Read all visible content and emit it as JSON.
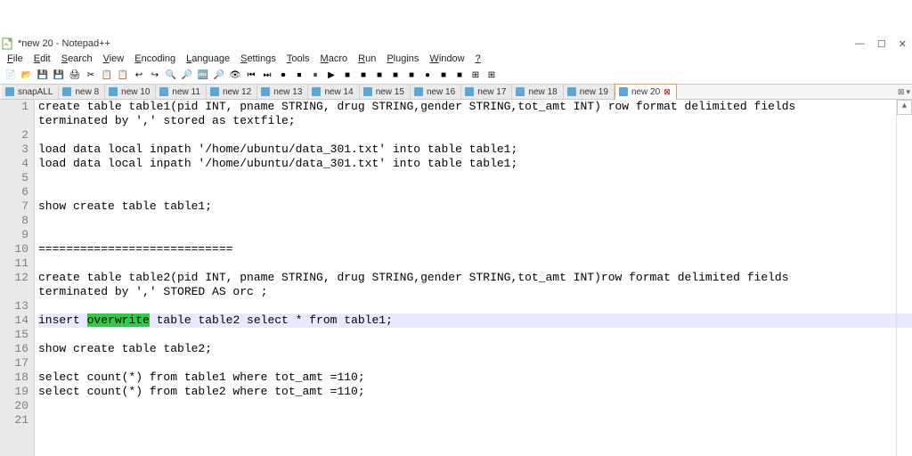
{
  "title": "*new 20 - Notepad++",
  "menu": [
    "File",
    "Edit",
    "Search",
    "View",
    "Encoding",
    "Language",
    "Settings",
    "Tools",
    "Macro",
    "Run",
    "Plugins",
    "Window",
    "?"
  ],
  "toolbar_icons": [
    "📄",
    "📂",
    "💾",
    "💾",
    "🖨",
    "✂",
    "📋",
    "📋",
    "↩",
    "↪",
    "🔍",
    "🔎",
    "🔤",
    "🔎",
    "👁",
    "⏮",
    "⏭",
    "⏺",
    "⏹",
    "⏸",
    "▶",
    "■",
    "■",
    "■",
    "■",
    "■",
    "●",
    "■",
    "■",
    "⊞",
    "⊞"
  ],
  "tabs": [
    {
      "label": "snapALL"
    },
    {
      "label": "new 8"
    },
    {
      "label": "new 10"
    },
    {
      "label": "new 11"
    },
    {
      "label": "new 12"
    },
    {
      "label": "new 13"
    },
    {
      "label": "new 14"
    },
    {
      "label": "new 15"
    },
    {
      "label": "new 16"
    },
    {
      "label": "new 17"
    },
    {
      "label": "new 18"
    },
    {
      "label": "new 19"
    }
  ],
  "active_tab": {
    "label": "new 20"
  },
  "lines": [
    {
      "n": 1,
      "text": "create table table1(pid INT, pname STRING, drug STRING,gender STRING,tot_amt INT) row format delimited fields"
    },
    {
      "n": null,
      "text": "terminated by ',' stored as textfile;"
    },
    {
      "n": 2,
      "text": ""
    },
    {
      "n": 3,
      "text": "load data local inpath '/home/ubuntu/data_301.txt' into table table1;"
    },
    {
      "n": 4,
      "text": "load data local inpath '/home/ubuntu/data_301.txt' into table table1;"
    },
    {
      "n": 5,
      "text": ""
    },
    {
      "n": 6,
      "text": ""
    },
    {
      "n": 7,
      "text": "show create table table1;"
    },
    {
      "n": 8,
      "text": ""
    },
    {
      "n": 9,
      "text": ""
    },
    {
      "n": 10,
      "text": "============================"
    },
    {
      "n": 11,
      "text": ""
    },
    {
      "n": 12,
      "text": "create table table2(pid INT, pname STRING, drug STRING,gender STRING,tot_amt INT)row format delimited fields"
    },
    {
      "n": null,
      "text": "terminated by ',' STORED AS orc ;"
    },
    {
      "n": 13,
      "text": ""
    },
    {
      "n": 14,
      "text": "insert overwrite table table2 select * from table1;",
      "highlight": true,
      "hl_word": "overwrite"
    },
    {
      "n": 15,
      "text": ""
    },
    {
      "n": 16,
      "text": "show create table table2;"
    },
    {
      "n": 17,
      "text": ""
    },
    {
      "n": 18,
      "text": "select count(*) from table1 where tot_amt =110;"
    },
    {
      "n": 19,
      "text": "select count(*) from table2 where tot_amt =110;"
    },
    {
      "n": 20,
      "text": ""
    },
    {
      "n": 21,
      "text": ""
    }
  ],
  "winbtn_min": "—",
  "winbtn_max": "☐",
  "winbtn_close": "✕",
  "tab_close": "⊠",
  "tab_menu": "▾",
  "scroll_up": "▲"
}
